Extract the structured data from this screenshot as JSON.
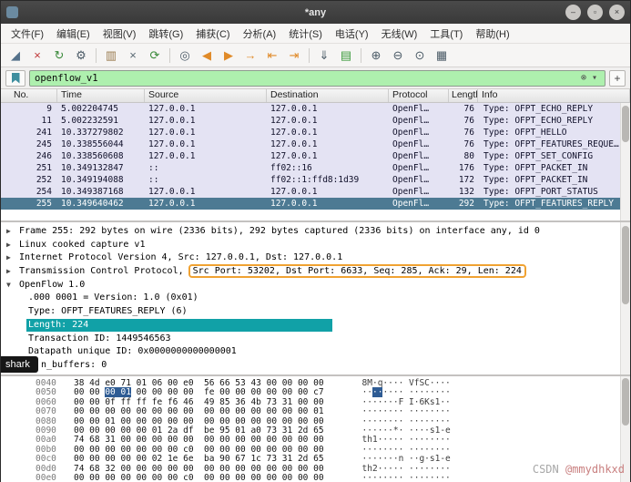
{
  "window": {
    "title": "*any",
    "minimize_label": "–",
    "maximize_label": "▫",
    "close_label": "×"
  },
  "menu_bar": {
    "items": [
      "文件(F)",
      "编辑(E)",
      "视图(V)",
      "跳转(G)",
      "捕获(C)",
      "分析(A)",
      "统计(S)",
      "电话(Y)",
      "无线(W)",
      "工具(T)",
      "帮助(H)"
    ]
  },
  "toolbar": {
    "icons": [
      {
        "name": "capture-start-icon",
        "glyph": "◢",
        "color": "#54718a"
      },
      {
        "name": "capture-stop-icon",
        "glyph": "×",
        "color": "#c03a3a"
      },
      {
        "name": "capture-restart-icon",
        "glyph": "↻",
        "color": "#3a8a3a"
      },
      {
        "name": "capture-options-icon",
        "glyph": "⚙",
        "color": "#4a5a66"
      },
      {
        "name": "separator"
      },
      {
        "name": "open-file-icon",
        "glyph": "▥",
        "color": "#9a7b4f"
      },
      {
        "name": "close-file-icon",
        "glyph": "×",
        "color": "#5a6a74"
      },
      {
        "name": "reload-icon",
        "glyph": "⟳",
        "color": "#3a8a3a"
      },
      {
        "name": "separator"
      },
      {
        "name": "find-packet-icon",
        "glyph": "◎",
        "color": "#4a5a66"
      },
      {
        "name": "go-back-icon",
        "glyph": "◀",
        "color": "#e08a28"
      },
      {
        "name": "go-forward-icon",
        "glyph": "▶",
        "color": "#e08a28"
      },
      {
        "name": "go-to-packet-icon",
        "glyph": "→",
        "color": "#e08a28"
      },
      {
        "name": "go-first-icon",
        "glyph": "⇤",
        "color": "#e08a28"
      },
      {
        "name": "go-last-icon",
        "glyph": "⇥",
        "color": "#e08a28"
      },
      {
        "name": "separator"
      },
      {
        "name": "autoscroll-icon",
        "glyph": "⇓",
        "color": "#4a5a66"
      },
      {
        "name": "colorize-icon",
        "glyph": "▤",
        "color": "#3a9a3a"
      },
      {
        "name": "separator"
      },
      {
        "name": "zoom-in-icon",
        "glyph": "⊕",
        "color": "#4a5a66"
      },
      {
        "name": "zoom-out-icon",
        "glyph": "⊖",
        "color": "#4a5a66"
      },
      {
        "name": "zoom-reset-icon",
        "glyph": "⊙",
        "color": "#4a5a66"
      },
      {
        "name": "resize-columns-icon",
        "glyph": "▦",
        "color": "#4a5a66"
      }
    ]
  },
  "filter_bar": {
    "value": "openflow_v1",
    "clear_icon": "⊗",
    "dropdown_icon": "▾",
    "add_icon": "+"
  },
  "packet_list": {
    "columns": [
      "No.",
      "Time",
      "Source",
      "Destination",
      "Protocol",
      "Length",
      "Info"
    ],
    "rows": [
      {
        "no": "9",
        "time": "5.002204745",
        "src": "127.0.0.1",
        "dst": "127.0.0.1",
        "proto": "OpenFl…",
        "len": "76",
        "info": "Type: OFPT_ECHO_REPLY",
        "selected": false
      },
      {
        "no": "11",
        "time": "5.002232591",
        "src": "127.0.0.1",
        "dst": "127.0.0.1",
        "proto": "OpenFl…",
        "len": "76",
        "info": "Type: OFPT_ECHO_REPLY",
        "selected": false
      },
      {
        "no": "241",
        "time": "10.337279802",
        "src": "127.0.0.1",
        "dst": "127.0.0.1",
        "proto": "OpenFl…",
        "len": "76",
        "info": "Type: OFPT_HELLO",
        "selected": false
      },
      {
        "no": "245",
        "time": "10.338556044",
        "src": "127.0.0.1",
        "dst": "127.0.0.1",
        "proto": "OpenFl…",
        "len": "76",
        "info": "Type: OFPT_FEATURES_REQUE…",
        "selected": false
      },
      {
        "no": "246",
        "time": "10.338560608",
        "src": "127.0.0.1",
        "dst": "127.0.0.1",
        "proto": "OpenFl…",
        "len": "80",
        "info": "Type: OFPT_SET_CONFIG",
        "selected": false
      },
      {
        "no": "251",
        "time": "10.349132847",
        "src": "::",
        "dst": "ff02::16",
        "proto": "OpenFl…",
        "len": "176",
        "info": "Type: OFPT_PACKET_IN",
        "selected": false
      },
      {
        "no": "252",
        "time": "10.349194088",
        "src": "::",
        "dst": "ff02::1:ffd8:1d39",
        "proto": "OpenFl…",
        "len": "172",
        "info": "Type: OFPT_PACKET_IN",
        "selected": false
      },
      {
        "no": "254",
        "time": "10.349387168",
        "src": "127.0.0.1",
        "dst": "127.0.0.1",
        "proto": "OpenFl…",
        "len": "132",
        "info": "Type: OFPT_PORT_STATUS",
        "selected": false
      },
      {
        "no": "255",
        "time": "10.349640462",
        "src": "127.0.0.1",
        "dst": "127.0.0.1",
        "proto": "OpenFl…",
        "len": "292",
        "info": "Type: OFPT_FEATURES_REPLY",
        "selected": true
      }
    ]
  },
  "packet_details": {
    "lines": [
      {
        "arrow": "▶",
        "indent": 0,
        "text": "Frame 255: 292 bytes on wire (2336 bits), 292 bytes captured (2336 bits) on interface any, id 0"
      },
      {
        "arrow": "▶",
        "indent": 0,
        "text": "Linux cooked capture v1"
      },
      {
        "arrow": "▶",
        "indent": 0,
        "text": "Internet Protocol Version 4, Src: 127.0.0.1, Dst: 127.0.0.1"
      },
      {
        "arrow": "▶",
        "indent": 0,
        "text": "Transmission Control Protocol, ",
        "boxed": "Src Port: 53202, Dst Port: 6633, Seq: 285, Ack: 29, Len: 224"
      },
      {
        "arrow": "▼",
        "indent": 0,
        "text": "OpenFlow 1.0"
      },
      {
        "indent": 1,
        "text": ".000 0001 = Version: 1.0 (0x01)"
      },
      {
        "indent": 1,
        "text": "Type: OFPT_FEATURES_REPLY (6)"
      },
      {
        "indent": 1,
        "text": "Length: 224",
        "selected": true
      },
      {
        "indent": 1,
        "text": "Transaction ID: 1449546563"
      },
      {
        "indent": 1,
        "text": "Datapath unique ID: 0x0000000000000001"
      },
      {
        "indent": 1,
        "text": "n_buffers: 0",
        "shifted": true
      }
    ]
  },
  "hex_dump": {
    "rows": [
      {
        "offset": "0040",
        "bytes": "38 4d e0 71 01 06 00 e0  56 66 53 43 00 00 00 00",
        "ascii": "8M·q···· VfSC····"
      },
      {
        "offset": "0050",
        "bytes_pre": "00 00 ",
        "bytes_sel": "00 01",
        "bytes_post": " 00 00 00 00  fe 00 00 00 00 00 00 c7",
        "ascii_pre": "··",
        "ascii_sel": "··",
        "ascii_post": "···· ········"
      },
      {
        "offset": "0060",
        "bytes": "00 00 0f ff ff fe f6 46  49 85 36 4b 73 31 00 00",
        "ascii": "·······F I·6Ks1··"
      },
      {
        "offset": "0070",
        "bytes": "00 00 00 00 00 00 00 00  00 00 00 00 00 00 00 01",
        "ascii": "········ ········"
      },
      {
        "offset": "0080",
        "bytes": "00 00 01 00 00 00 00 00  00 00 00 00 00 00 00 00",
        "ascii": "········ ········"
      },
      {
        "offset": "0090",
        "bytes": "00 00 00 00 00 01 2a df  be 95 01 a0 73 31 2d 65",
        "ascii": "······*· ····s1-e"
      },
      {
        "offset": "00a0",
        "bytes": "74 68 31 00 00 00 00 00  00 00 00 00 00 00 00 00",
        "ascii": "th1····· ········"
      },
      {
        "offset": "00b0",
        "bytes": "00 00 00 00 00 00 00 c0  00 00 00 00 00 00 00 00",
        "ascii": "········ ········"
      },
      {
        "offset": "00c0",
        "bytes": "00 00 00 00 00 02 1e 6e  ba 90 67 1c 73 31 2d 65",
        "ascii": "·······n ··g·s1-e"
      },
      {
        "offset": "00d0",
        "bytes": "74 68 32 00 00 00 00 00  00 00 00 00 00 00 00 00",
        "ascii": "th2····· ········"
      },
      {
        "offset": "00e0",
        "bytes": "00 00 00 00 00 00 00 c0  00 00 00 00 00 00 00 00",
        "ascii": "········ ········"
      }
    ]
  },
  "overlay": {
    "tooltip_text": "shark",
    "watermark_prefix": "CSDN ",
    "watermark_user": "@mmydhkxd"
  }
}
